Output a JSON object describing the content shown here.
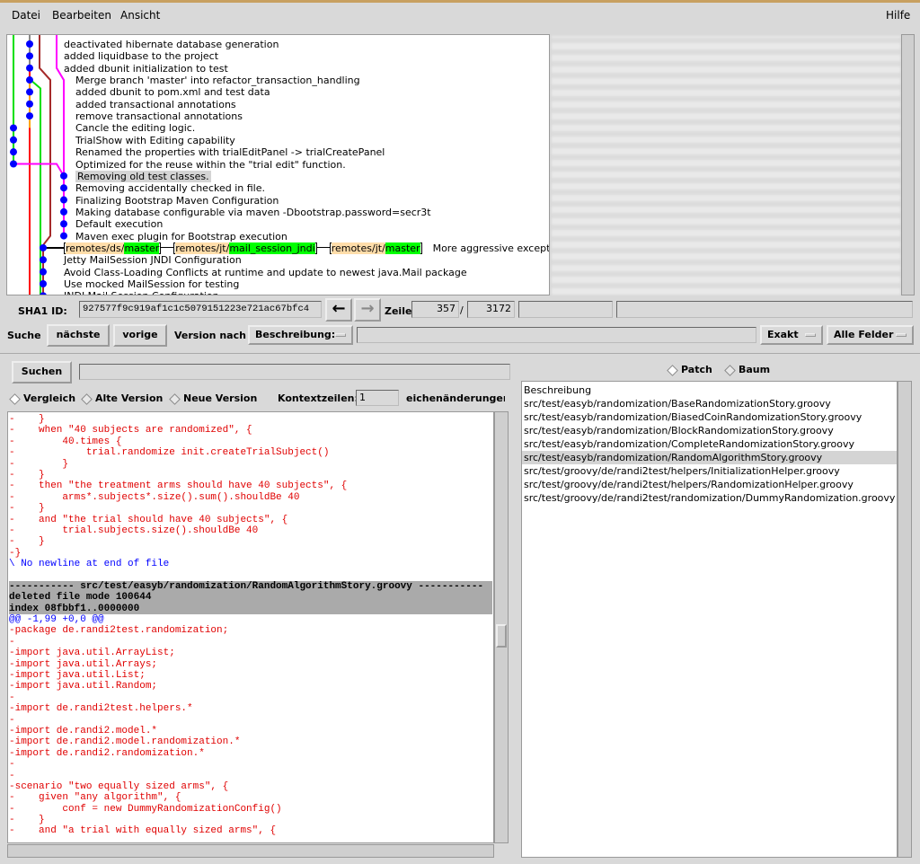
{
  "menu": {
    "file": "Datei",
    "edit": "Bearbeiten",
    "view": "Ansicht",
    "help": "Hilfe"
  },
  "commits": [
    "deactivated hibernate database generation",
    "added liquidbase to the project",
    "added dbunit initialization to test",
    "Merge branch 'master' into refactor_transaction_handling",
    "added dbunit to pom.xml and test data",
    "added transactional annotations",
    "remove transactional annotations",
    "Cancle the editing logic.",
    "TrialShow with Editing capability",
    "Renamed the properties with trialEditPanel -> trialCreatePanel",
    "Optimized for the reuse within the \"trial edit\" function.",
    "Removing old test classes.",
    "Removing accidentally checked in file.",
    "Finalizing Bootstrap Maven Configuration",
    "Making database configurable via maven -Dbootstrap.password=secr3t",
    "Default execution",
    "Maven exec plugin for Bootstrap execution",
    "More aggressive exception",
    "Jetty MailSession JNDI Configuration",
    "Avoid Class-Loading Conflicts at runtime and update to newest java.Mail package",
    "Use mocked MailSession for testing",
    "JNDI Mail Session Configuration"
  ],
  "selected_commit": "Removing old test classes.",
  "tags": [
    {
      "remote": "remotes/ds/",
      "branch": "master"
    },
    {
      "remote": "remotes/jt/",
      "branch": "mail_session_jndi"
    },
    {
      "remote": "remotes/jt/",
      "branch": "master"
    }
  ],
  "colors": {
    "head_branch": "#00ff00",
    "remote_prefix": "#ffddaa",
    "commit_dot": "#0000ff",
    "deleted_line": "#e00000",
    "hunk": "#0000ff"
  },
  "sha": {
    "label": "SHA1 ID:",
    "value": "927577f9c919af1c1c5079151223e721ac67bfc4"
  },
  "line": {
    "label": "Zeile",
    "current": "357",
    "sep": "/",
    "total": "3172"
  },
  "find": {
    "label": "Suche",
    "next": "nächste",
    "prev": "vorige",
    "version_by": "Version nach",
    "field_type": "Beschreibung:",
    "match": "Exakt",
    "scope": "Alle Felder"
  },
  "search": {
    "button": "Suchen"
  },
  "diffmode": {
    "diff": "Vergleich",
    "old": "Alte Version",
    "new": "Neue Version",
    "context_label": "Kontextzeilen:",
    "context": "1",
    "ignore_ws": "eichenänderungen ig"
  },
  "view": {
    "patch": "Patch",
    "tree": "Baum"
  },
  "diff_lines": [
    {
      "t": "-    }",
      "c": "d"
    },
    {
      "t": "-    when \"40 subjects are randomized\", {",
      "c": "d"
    },
    {
      "t": "-        40.times {",
      "c": "d"
    },
    {
      "t": "-            trial.randomize init.createTrialSubject()",
      "c": "d"
    },
    {
      "t": "-        }",
      "c": "d"
    },
    {
      "t": "-    }",
      "c": "d"
    },
    {
      "t": "-    then \"the treatment arms should have 40 subjects\", {",
      "c": "d"
    },
    {
      "t": "-        arms*.subjects*.size().sum().shouldBe 40",
      "c": "d"
    },
    {
      "t": "-    }",
      "c": "d"
    },
    {
      "t": "-    and \"the trial should have 40 subjects\", {",
      "c": "d"
    },
    {
      "t": "-        trial.subjects.size().shouldBe 40",
      "c": "d"
    },
    {
      "t": "-    }",
      "c": "d"
    },
    {
      "t": "-}",
      "c": "d"
    },
    {
      "t": "\\ No newline at end of file",
      "c": "h"
    },
    {
      "t": "",
      "c": ""
    },
    {
      "t": "----------- src/test/easyb/randomization/RandomAlgorithmStory.groovy -----------",
      "c": "fh"
    },
    {
      "t": "deleted file mode 100644",
      "c": "fh"
    },
    {
      "t": "index 08fbbf1..0000000",
      "c": "fh"
    },
    {
      "t": "@@ -1,99 +0,0 @@",
      "c": "h"
    },
    {
      "t": "-package de.randi2test.randomization;",
      "c": "d"
    },
    {
      "t": "-",
      "c": "d"
    },
    {
      "t": "-import java.util.ArrayList;",
      "c": "d"
    },
    {
      "t": "-import java.util.Arrays;",
      "c": "d"
    },
    {
      "t": "-import java.util.List;",
      "c": "d"
    },
    {
      "t": "-import java.util.Random;",
      "c": "d"
    },
    {
      "t": "-",
      "c": "d"
    },
    {
      "t": "-import de.randi2test.helpers.*",
      "c": "d"
    },
    {
      "t": "-",
      "c": "d"
    },
    {
      "t": "-import de.randi2.model.*",
      "c": "d"
    },
    {
      "t": "-import de.randi2.model.randomization.*",
      "c": "d"
    },
    {
      "t": "-import de.randi2.randomization.*",
      "c": "d"
    },
    {
      "t": "-",
      "c": "d"
    },
    {
      "t": "-",
      "c": "d"
    },
    {
      "t": "-scenario \"two equally sized arms\", {",
      "c": "d"
    },
    {
      "t": "-    given \"any algorithm\", {",
      "c": "d"
    },
    {
      "t": "-        conf = new DummyRandomizationConfig()",
      "c": "d"
    },
    {
      "t": "-    }",
      "c": "d"
    },
    {
      "t": "-    and \"a trial with equally sized arms\", {",
      "c": "d"
    }
  ],
  "files": [
    "Beschreibung",
    "src/test/easyb/randomization/BaseRandomizationStory.groovy",
    "src/test/easyb/randomization/BiasedCoinRandomizationStory.groovy",
    "src/test/easyb/randomization/BlockRandomizationStory.groovy",
    "src/test/easyb/randomization/CompleteRandomizationStory.groovy",
    "src/test/easyb/randomization/RandomAlgorithmStory.groovy",
    "src/test/groovy/de/randi2test/helpers/InitializationHelper.groovy",
    "src/test/groovy/de/randi2test/helpers/RandomizationHelper.groovy",
    "src/test/groovy/de/randi2test/randomization/DummyRandomization.groovy"
  ],
  "selected_file": "src/test/easyb/randomization/RandomAlgorithmStory.groovy"
}
